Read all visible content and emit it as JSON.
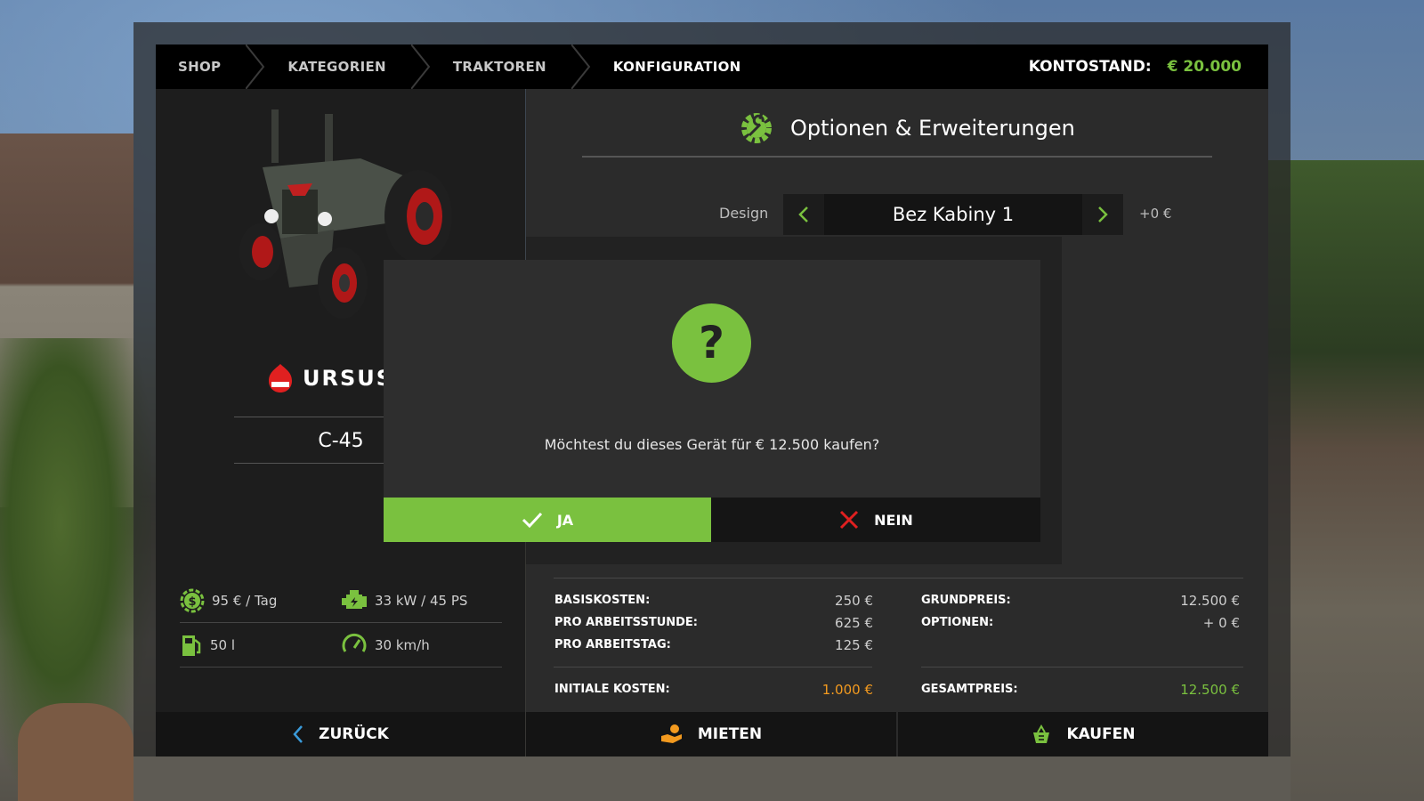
{
  "breadcrumb": {
    "items": [
      {
        "label": "SHOP"
      },
      {
        "label": "KATEGORIEN"
      },
      {
        "label": "TRAKTOREN"
      },
      {
        "label": "KONFIGURATION"
      }
    ]
  },
  "account": {
    "label": "KONTOSTAND:",
    "amount": "€ 20.000"
  },
  "vehicle": {
    "brand": "URSUS",
    "model": "C-45",
    "specs": {
      "cost_per_day": "95 € / Tag",
      "power": "33 kW / 45 PS",
      "fuel": "50 l",
      "speed": "30 km/h"
    }
  },
  "options": {
    "title": "Optionen & Erweiterungen",
    "design_label": "Design",
    "design_value": "Bez Kabiny 1",
    "design_price": "+0 €"
  },
  "dialog": {
    "question_mark": "?",
    "message": "Möchtest du dieses Gerät für € 12.500 kaufen?",
    "yes_label": "JA",
    "no_label": "NEIN"
  },
  "costs": {
    "left": [
      {
        "label": "BASISKOSTEN:",
        "value": "250 €"
      },
      {
        "label": "PRO ARBEITSSTUNDE:",
        "value": "625 €"
      },
      {
        "label": "PRO ARBEITSTAG:",
        "value": "125 €"
      }
    ],
    "initial": {
      "label": "INITIALE KOSTEN:",
      "value": "1.000 €"
    },
    "right": [
      {
        "label": "GRUNDPREIS:",
        "value": "12.500 €"
      },
      {
        "label": "OPTIONEN:",
        "value": "+ 0 €"
      }
    ],
    "total": {
      "label": "GESAMTPREIS:",
      "value": "12.500 €"
    }
  },
  "bottom": {
    "back_label": "ZURÜCK",
    "lease_label": "MIETEN",
    "buy_label": "KAUFEN"
  },
  "colors": {
    "accent": "#7ac13f",
    "orange": "#f39a1f",
    "danger": "#e02020"
  }
}
